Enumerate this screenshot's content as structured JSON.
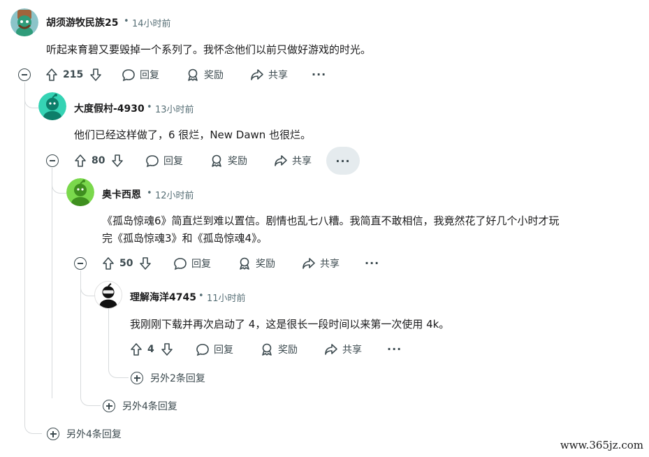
{
  "comments": [
    {
      "author": "胡须游牧民族25",
      "sep": "•",
      "time": "14小时前",
      "text": "听起来育碧又要毁掉一个系列了。我怀念他们以前只做好游戏的时光。",
      "votes": "215",
      "reply": "回复",
      "award": "奖励",
      "share": "共享",
      "more": "···",
      "avatar_color": "#8bc4c9"
    },
    {
      "author": "大度假村-4930",
      "sep": "•",
      "time": "13小时前",
      "text": "他们已经这样做了，6 很烂，New Dawn 也很烂。",
      "votes": "80",
      "reply": "回复",
      "award": "奖励",
      "share": "共享",
      "more": "···",
      "avatar_color": "#35d3b4"
    },
    {
      "author": "奥卡西恩",
      "sep": "•",
      "time": "12小时前",
      "text_line1": "《孤岛惊魂6》简直烂到难以置信。剧情也乱七八糟。我简直不敢相信，我竟然花了好几个小时才玩",
      "text_line2": "完《孤岛惊魂3》和《孤岛惊魂4》。",
      "votes": "50",
      "reply": "回复",
      "award": "奖励",
      "share": "共享",
      "more": "···",
      "avatar_color": "#7ad84c"
    },
    {
      "author": "理解海洋4745",
      "sep": "•",
      "time": "11小时前",
      "text": "我刚刚下载并再次启动了 4，这是很长一段时间以来第一次使用 4k。",
      "votes": "4",
      "reply": "回复",
      "award": "奖励",
      "share": "共享",
      "more": "···",
      "avatar_color": "#ffffff"
    }
  ],
  "more_replies": {
    "level4": "另外2条回复",
    "level3": "另外4条回复",
    "level1": "另外4条回复"
  },
  "watermark": "www.365jz.com"
}
